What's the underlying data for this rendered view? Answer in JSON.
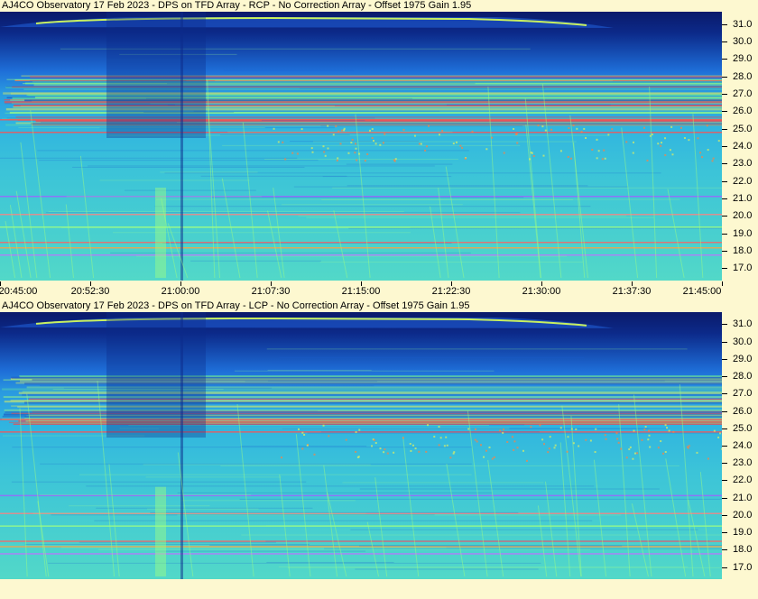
{
  "panels": [
    {
      "title": "AJ4CO Observatory 17 Feb 2023 - DPS on TFD Array  - RCP  -  No Correction Array  -  Offset 1975  Gain 1.95",
      "polarization": "RCP"
    },
    {
      "title": "AJ4CO Observatory 17 Feb 2023 - DPS on TFD Array  - LCP  -  No Correction Array  -  Offset 1975  Gain 1.95",
      "polarization": "LCP"
    }
  ],
  "frequency_axis": {
    "ticks": [
      "31.0",
      "30.0",
      "29.0",
      "28.0",
      "27.0",
      "26.0",
      "25.0",
      "24.0",
      "23.0",
      "22.0",
      "21.0",
      "20.0",
      "19.0",
      "18.0",
      "17.0"
    ],
    "max": 31.7,
    "min": 16.3
  },
  "time_axis": {
    "labels": [
      "20:45:00",
      "20:52:30",
      "21:00:00",
      "21:07:30",
      "21:15:00",
      "21:22:30",
      "21:30:00",
      "21:37:30",
      "21:45:00"
    ]
  },
  "colors": {
    "background": "#fdf8d0",
    "low": "#0a1a6a",
    "mid": "#1e6ed8",
    "high": "#3cc4d8",
    "hot": "#a0ff80",
    "rfi": "#ff4040"
  }
}
